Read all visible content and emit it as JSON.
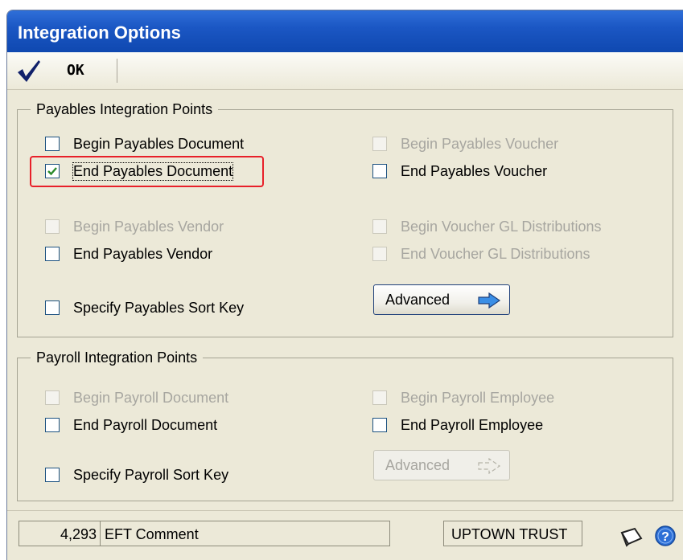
{
  "window": {
    "title": "Integration Options"
  },
  "toolbar": {
    "ok_label": "OK"
  },
  "payables": {
    "title": "Payables Integration Points",
    "begin_document": {
      "label": "Begin Payables Document",
      "checked": false,
      "enabled": true
    },
    "end_document": {
      "label": "End Payables Document",
      "checked": true,
      "enabled": true
    },
    "begin_vendor": {
      "label": "Begin Payables Vendor",
      "checked": false,
      "enabled": false
    },
    "end_vendor": {
      "label": "End Payables Vendor",
      "checked": false,
      "enabled": true
    },
    "sort_key": {
      "label": "Specify Payables Sort Key",
      "checked": false,
      "enabled": true
    },
    "begin_voucher": {
      "label": "Begin Payables Voucher",
      "checked": false,
      "enabled": false
    },
    "end_voucher": {
      "label": "End Payables Voucher",
      "checked": false,
      "enabled": true
    },
    "begin_voucher_gl": {
      "label": "Begin Voucher GL Distributions",
      "checked": false,
      "enabled": false
    },
    "end_voucher_gl": {
      "label": "End Voucher GL Distributions",
      "checked": false,
      "enabled": false
    },
    "advanced_label": "Advanced"
  },
  "payroll": {
    "title": "Payroll Integration Points",
    "begin_document": {
      "label": "Begin Payroll Document",
      "checked": false,
      "enabled": false
    },
    "end_document": {
      "label": "End Payroll Document",
      "checked": false,
      "enabled": true
    },
    "sort_key": {
      "label": "Specify Payroll Sort Key",
      "checked": false,
      "enabled": true
    },
    "begin_employee": {
      "label": "Begin Payroll Employee",
      "checked": false,
      "enabled": false
    },
    "end_employee": {
      "label": "End Payroll Employee",
      "checked": false,
      "enabled": true
    },
    "advanced_label": "Advanced"
  },
  "status": {
    "count": "4,293",
    "comment": "EFT Comment",
    "bank": "UPTOWN TRUST"
  },
  "icons": {
    "ok": "checkmark-icon",
    "advanced": "arrow-right-icon",
    "note": "note-icon",
    "help": "help-icon"
  },
  "colors": {
    "titlebar": "#1b57c4",
    "highlight": "#e8202a",
    "check": "#2a8a2a",
    "help": "#2d6fd6"
  }
}
